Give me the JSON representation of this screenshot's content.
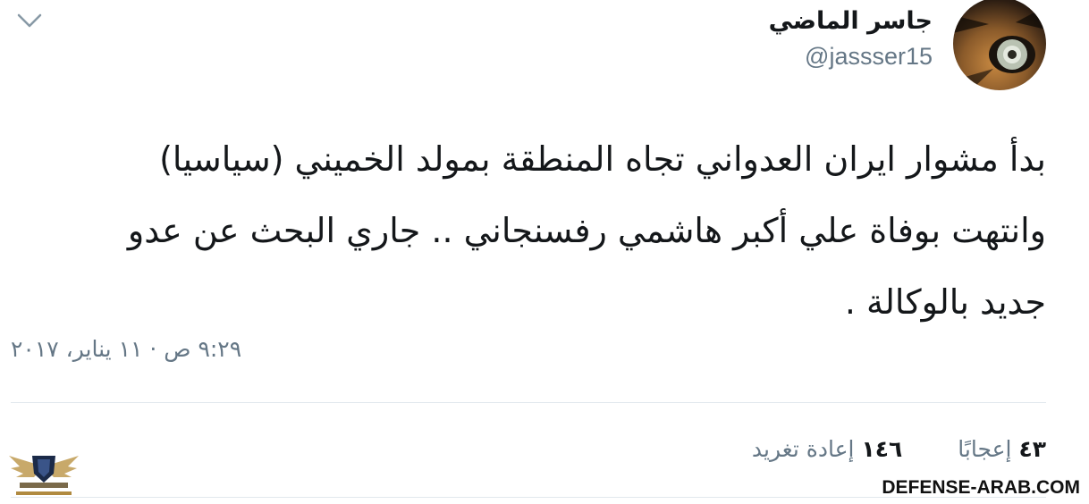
{
  "user": {
    "display_name": "جاسر الماضي",
    "handle": "@jassser15"
  },
  "tweet": {
    "text_lines": [
      "بدأ مشوار ايران العدواني تجاه المنطقة بمولد الخميني (سياسيا)",
      "وانتهت بوفاة علي أكبر هاشمي رفسنجاني .. جاري البحث عن عدو",
      "جديد بالوكالة ."
    ],
    "timestamp": "٩:٢٩ ص · ١١ يناير، ٢٠١٧"
  },
  "stats": {
    "retweets_count": "١٤٦",
    "retweets_label": "إعادة تغريد",
    "likes_count": "٤٣",
    "likes_label": "إعجابًا"
  },
  "watermark": {
    "site": "DEFENSE-ARAB.COM"
  },
  "icons": {
    "menu": "chevron-down-icon",
    "avatar": "tiger-eye-avatar",
    "logo": "eagle-logo"
  },
  "colors": {
    "text": "#14171a",
    "secondary": "#657786",
    "divider": "#e1e8ed"
  }
}
